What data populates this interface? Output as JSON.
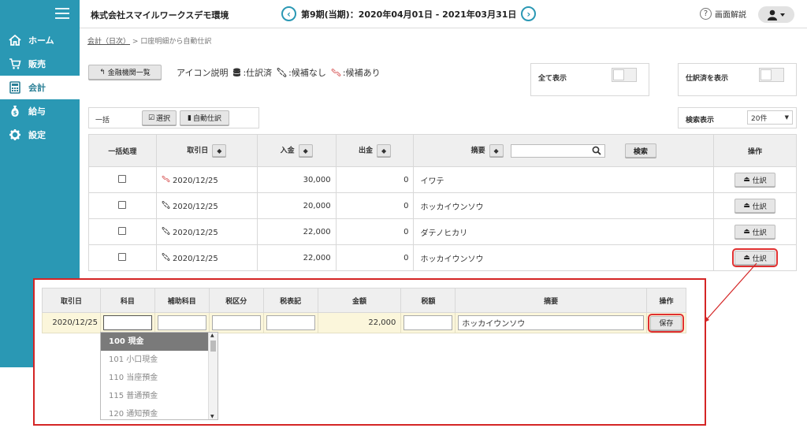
{
  "header": {
    "company": "株式会社スマイルワークスデモ環境",
    "period": "第9期(当期)：2020年04月01日 - 2021年03月31日",
    "help": "画面解説"
  },
  "sidebar": {
    "items": [
      {
        "label": "ホーム",
        "icon": "home-icon"
      },
      {
        "label": "販売",
        "icon": "cart-icon"
      },
      {
        "label": "会計",
        "icon": "calculator-icon",
        "active": true
      },
      {
        "label": "給与",
        "icon": "money-bag-icon"
      },
      {
        "label": "設定",
        "icon": "gear-icon"
      }
    ]
  },
  "breadcrumb": {
    "link": "会計（日次）",
    "sep": ">",
    "current": "口座明細から自動仕訳"
  },
  "toolbar": {
    "bank_list": "金融機関一覧",
    "legend_title": "アイコン説明",
    "legend_done": ":仕訳済",
    "legend_none": ":候補なし",
    "legend_some": ":候補あり"
  },
  "filters": {
    "show_all": "全て表示",
    "show_done": "仕訳済を表示",
    "bulk": "一括",
    "select": "選択",
    "auto": "自動仕訳",
    "count_label": "検索表示",
    "count_value": "20件"
  },
  "table": {
    "headers": {
      "bulk": "一括処理",
      "date": "取引日",
      "in": "入金",
      "out": "出金",
      "memo": "摘要",
      "search": "検索",
      "op": "操作"
    },
    "action_label": "仕訳",
    "rows": [
      {
        "date": "2020/12/25",
        "in": "30,000",
        "out": "0",
        "memo": "イワテ",
        "status": "candidate"
      },
      {
        "date": "2020/12/25",
        "in": "20,000",
        "out": "0",
        "memo": "ホッカイウンソウ",
        "status": "none"
      },
      {
        "date": "2020/12/25",
        "in": "22,000",
        "out": "0",
        "memo": "ダテノヒカリ",
        "status": "none"
      },
      {
        "date": "2020/12/25",
        "in": "22,000",
        "out": "0",
        "memo": "ホッカイウンソウ",
        "status": "none"
      }
    ]
  },
  "entry": {
    "headers": [
      "取引日",
      "科目",
      "補助科目",
      "税区分",
      "税表記",
      "金額",
      "税額",
      "摘要",
      "操作"
    ],
    "date": "2020/12/25",
    "amount": "22,000",
    "memo": "ホッカイウンソウ",
    "save": "保存",
    "options": [
      "100 現金",
      "101 小口現金",
      "110 当座預金",
      "115 普通預金",
      "120 通知預金"
    ]
  },
  "colors": {
    "sidebar": "#2a98b4",
    "highlight": "#d42525",
    "entry_row": "#fbf6db"
  }
}
